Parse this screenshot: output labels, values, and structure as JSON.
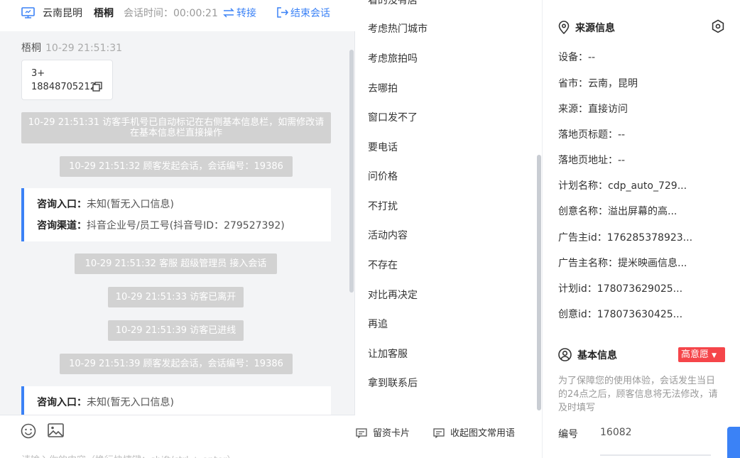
{
  "chat": {
    "header": {
      "city": "云南昆明",
      "user": "梧桐",
      "timer": "会话时间：00:00:21",
      "transfer": "转接",
      "end": "结束会话"
    },
    "visitor_msg": {
      "name": "梧桐",
      "time": "10-29 21:51:31",
      "text_line1": "3+",
      "text_line2": "18848705212"
    },
    "system": [
      "10-29 21:51:31 访客手机号已自动标记在右侧基本信息栏，如需修改请在基本信息栏直接操作",
      "10-29 21:51:32 顾客发起会话，会话编号：19386",
      "10-29 21:51:32 客服 超级管理员 接入会话",
      "10-29 21:51:33 访客已离开",
      "10-29 21:51:39 访客已进线",
      "10-29 21:51:39 顾客发起会话，会话编号：19386"
    ],
    "card1": {
      "entry_key": "咨询入口：",
      "entry_val": "未知(暂无入口信息)",
      "channel_key": "咨询渠道：",
      "channel_val": "抖音企业号/员工号(抖音号ID：279527392)"
    },
    "card2": {
      "entry_key": "咨询入口：",
      "entry_val": "未知(暂无入口信息)"
    },
    "input_placeholder": "请输入你的内容（换行快捷键：shift/ctrl + enter）"
  },
  "phrases": {
    "items": [
      "看的没有店",
      "考虑热门城市",
      "考虑旅拍吗",
      "去哪拍",
      "窗口发不了",
      "要电话",
      "问价格",
      "不打扰",
      "活动内容",
      "不存在",
      "对比再决定",
      "再追",
      "让加客服",
      "拿到联系后"
    ],
    "card_btn": "留资卡片",
    "collapse_btn": "收起图文常用语"
  },
  "info": {
    "source_title": "来源信息",
    "rows": [
      "设备：--",
      "省市：云南，昆明",
      "来源：直接访问",
      "落地页标题：--",
      "落地页地址：--",
      "计划名称：cdp_auto_729...",
      "创意名称：溢出屏幕的高...",
      "广告主id：176285378923...",
      "广告主名称：提米映画信息...",
      "计划id：178073629025...",
      "创意id：178073630425..."
    ],
    "basic_title": "基本信息",
    "intent_badge": "高意愿",
    "notice": "为了保障您的使用体验，会话发生当日的24点之后，顾客信息将无法修改，请及时填写",
    "id_label": "编号",
    "id_value": "16082"
  },
  "colors": {
    "accent": "#3b82f6",
    "badge": "#f5454a",
    "system_pill": "#d2d2d2"
  }
}
